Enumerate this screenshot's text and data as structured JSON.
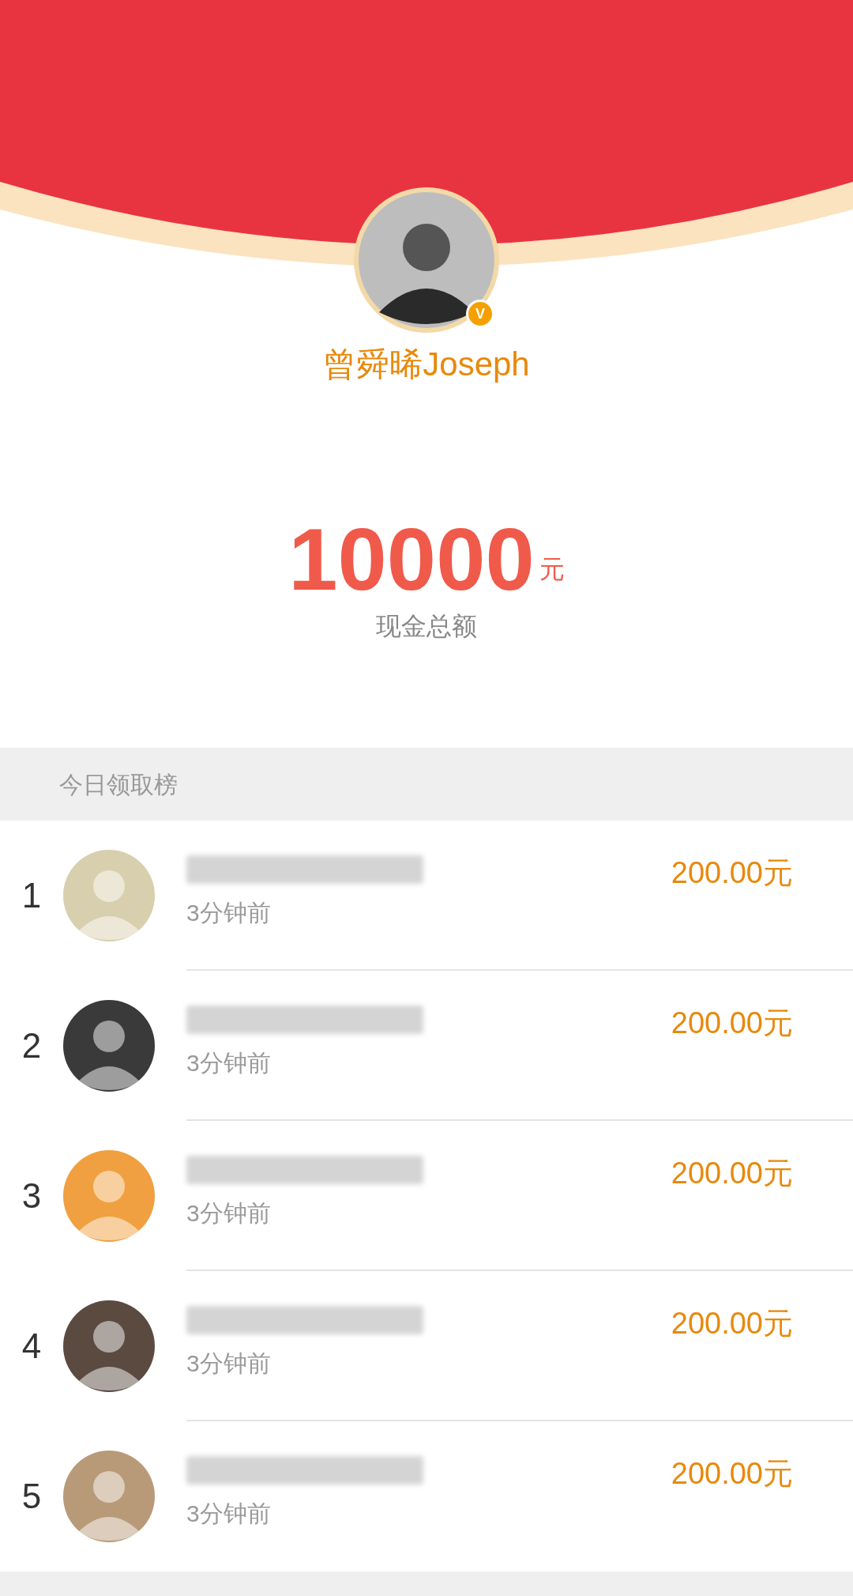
{
  "profile": {
    "name": "曾舜晞Joseph",
    "badge": "V"
  },
  "total": {
    "amount": "10000",
    "unit": "元",
    "label": "现金总额"
  },
  "leaderboard": {
    "title": "今日领取榜",
    "rows": [
      {
        "rank": "1",
        "time": "3分钟前",
        "amount": "200.00元"
      },
      {
        "rank": "2",
        "time": "3分钟前",
        "amount": "200.00元"
      },
      {
        "rank": "3",
        "time": "3分钟前",
        "amount": "200.00元"
      },
      {
        "rank": "4",
        "time": "3分钟前",
        "amount": "200.00元"
      },
      {
        "rank": "5",
        "time": "3分钟前",
        "amount": "200.00元"
      }
    ]
  }
}
